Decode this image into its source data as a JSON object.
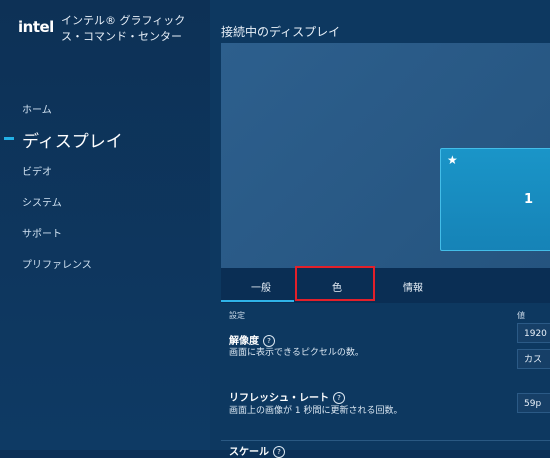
{
  "sidebar": {
    "logo": "intel",
    "app_title": "インテル® グラフィックス・コマンド・センター",
    "items": [
      {
        "label": "ホーム"
      },
      {
        "label": "ディスプレイ"
      },
      {
        "label": "ビデオ"
      },
      {
        "label": "システム"
      },
      {
        "label": "サポート"
      },
      {
        "label": "プリファレンス"
      }
    ]
  },
  "main": {
    "section_title": "接続中のディスプレイ",
    "preview": {
      "monitor_number": "1",
      "star": "★"
    },
    "tabs": [
      {
        "label": "一般"
      },
      {
        "label": "色"
      },
      {
        "label": "情報"
      }
    ],
    "settings_header": {
      "setting": "設定",
      "value": "値"
    },
    "settings": [
      {
        "title": "解像度",
        "desc": "画面に表示できるピクセルの数。",
        "value": "1920",
        "value2": "カス"
      },
      {
        "title": "リフレッシュ・レート",
        "desc": "画面上の画像が 1 秒間に更新される回数。",
        "value": "59p"
      },
      {
        "title": "スケール"
      }
    ],
    "help_icon": "?"
  },
  "colors": {
    "accent": "#23b1e6",
    "highlight": "#e3202a"
  }
}
